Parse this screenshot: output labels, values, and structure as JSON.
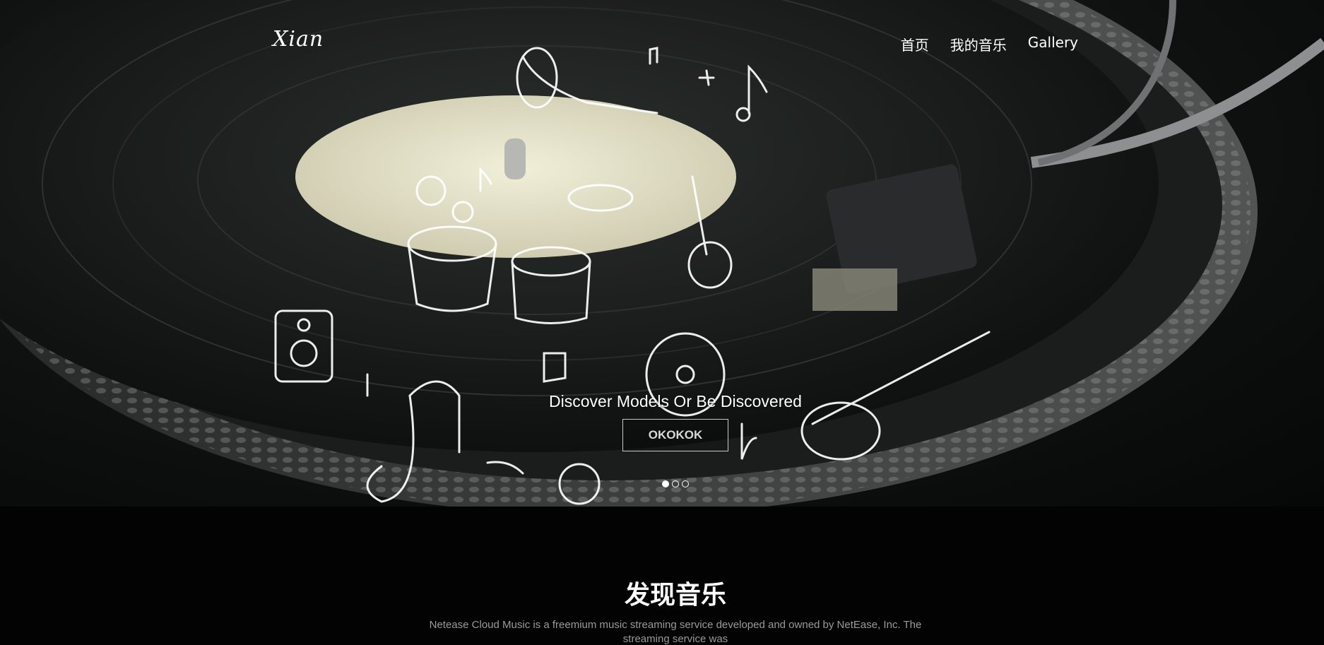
{
  "header": {
    "logo": "Xian",
    "nav": [
      "首页",
      "我的音乐",
      "Gallery"
    ]
  },
  "hero": {
    "caption": "Discover Models Or Be Discovered",
    "cta_label": "OKOKOK",
    "active_slide": 1,
    "slide_count": 3
  },
  "section": {
    "title": "发现音乐",
    "description": "Netease Cloud Music is a freemium music streaming service developed and owned by NetEase, Inc. The streaming service was"
  },
  "colors": {
    "page_bg": "#030303",
    "text_primary": "#ffffff",
    "text_muted": "#9a9a9a",
    "label_cream": "#e8e6cf"
  },
  "icons": [
    "vinyl-record-illustration",
    "tonearm-illustration",
    "music-doodles-illustration"
  ]
}
